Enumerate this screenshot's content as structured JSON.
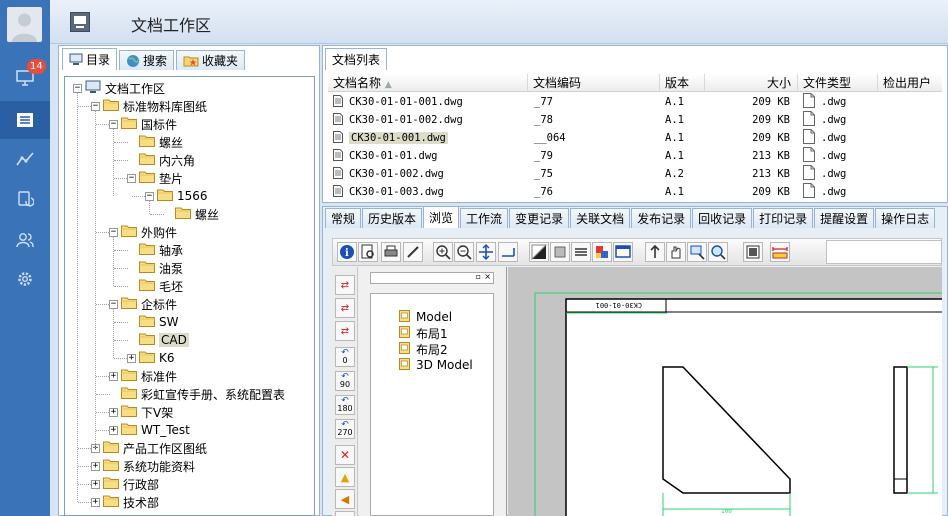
{
  "sidebar": {
    "badge_count": "14",
    "nav": [
      {
        "icon": "monitor-icon"
      },
      {
        "icon": "list-icon"
      },
      {
        "icon": "trend-icon"
      },
      {
        "icon": "refresh-doc-icon"
      },
      {
        "icon": "users-icon"
      },
      {
        "icon": "settings-icon"
      }
    ]
  },
  "header": {
    "title": "文档工作区"
  },
  "left_tabs": [
    "目录",
    "搜索",
    "收藏夹"
  ],
  "tree": [
    {
      "label": "文档工作区"
    },
    {
      "label": "标准物料库图纸"
    },
    {
      "label": "国标件"
    },
    {
      "label": "螺丝"
    },
    {
      "label": "内六角"
    },
    {
      "label": "垫片"
    },
    {
      "label": "1566"
    },
    {
      "label": "螺丝"
    },
    {
      "label": "外购件"
    },
    {
      "label": "轴承"
    },
    {
      "label": "油泵"
    },
    {
      "label": "毛坯"
    },
    {
      "label": "企标件"
    },
    {
      "label": "SW"
    },
    {
      "label": "CAD"
    },
    {
      "label": "K6"
    },
    {
      "label": "标准件"
    },
    {
      "label": "彩虹宣传手册、系统配置表"
    },
    {
      "label": "下V架"
    },
    {
      "label": "WT_Test"
    },
    {
      "label": "产品工作区图纸"
    },
    {
      "label": "系统功能资料"
    },
    {
      "label": "行政部"
    },
    {
      "label": "技术部"
    }
  ],
  "file_list": {
    "tab": "文档列表",
    "columns": [
      "文档名称",
      "文档编码",
      "版本",
      "大小",
      "文件类型",
      "检出用户"
    ],
    "rows": [
      {
        "name": "CK30-01-01-001.dwg",
        "code": "_77",
        "ver": "A.1",
        "size": "209 KB",
        "type": ".dwg"
      },
      {
        "name": "CK30-01-01-002.dwg",
        "code": "_78",
        "ver": "A.1",
        "size": "209 KB",
        "type": ".dwg"
      },
      {
        "name": "CK30-01-001.dwg",
        "code": "__064",
        "ver": "A.1",
        "size": "209 KB",
        "type": ".dwg"
      },
      {
        "name": "CK30-01-01.dwg",
        "code": "_79",
        "ver": "A.1",
        "size": "213 KB",
        "type": ".dwg"
      },
      {
        "name": "CK30-01-002.dwg",
        "code": "_75",
        "ver": "A.2",
        "size": "213 KB",
        "type": ".dwg"
      },
      {
        "name": "CK30-01-003.dwg",
        "code": "_76",
        "ver": "A.1",
        "size": "209 KB",
        "type": ".dwg"
      }
    ]
  },
  "detail_tabs": [
    "常规",
    "历史版本",
    "浏览",
    "工作流",
    "变更记录",
    "关联文档",
    "发布记录",
    "回收记录",
    "打印记录",
    "提醒设置",
    "操作日志"
  ],
  "viewer": {
    "layouts": [
      "Model",
      "布局1",
      "布局2",
      "3D Model"
    ],
    "rotate_labels": [
      "0",
      "90",
      "180",
      "270"
    ],
    "drawing_label": "CK30-01-001",
    "dim_label": "100"
  }
}
